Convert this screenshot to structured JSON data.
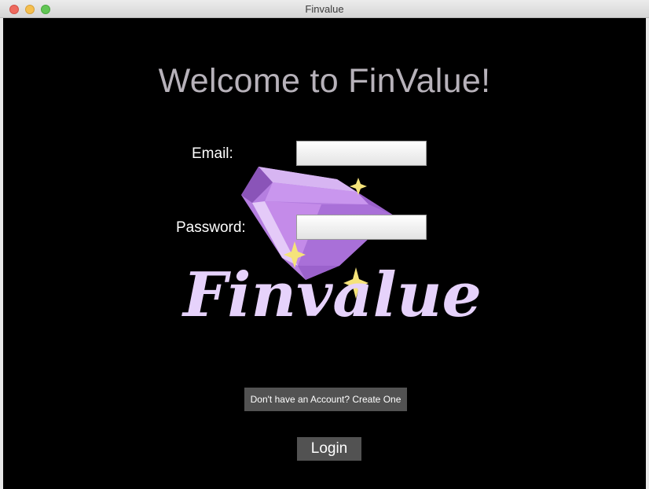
{
  "window": {
    "title": "Finvalue"
  },
  "main": {
    "heading": "Welcome to FinValue!",
    "email_label": "Email:",
    "email_value": "",
    "password_label": "Password:",
    "password_value": "",
    "create_account_label": "Don't have an Account? Create One",
    "login_label": "Login"
  },
  "logo": {
    "wordmark": "Finvalue",
    "icon": "gem-icon",
    "sparkle_icon": "sparkle-icon"
  },
  "colors": {
    "background": "#000000",
    "heading": "#b7b2ba",
    "button": "#525252",
    "gem": "#b57ee0",
    "sparkle": "#f5e37a",
    "wordmark": "#e6d2fb"
  }
}
